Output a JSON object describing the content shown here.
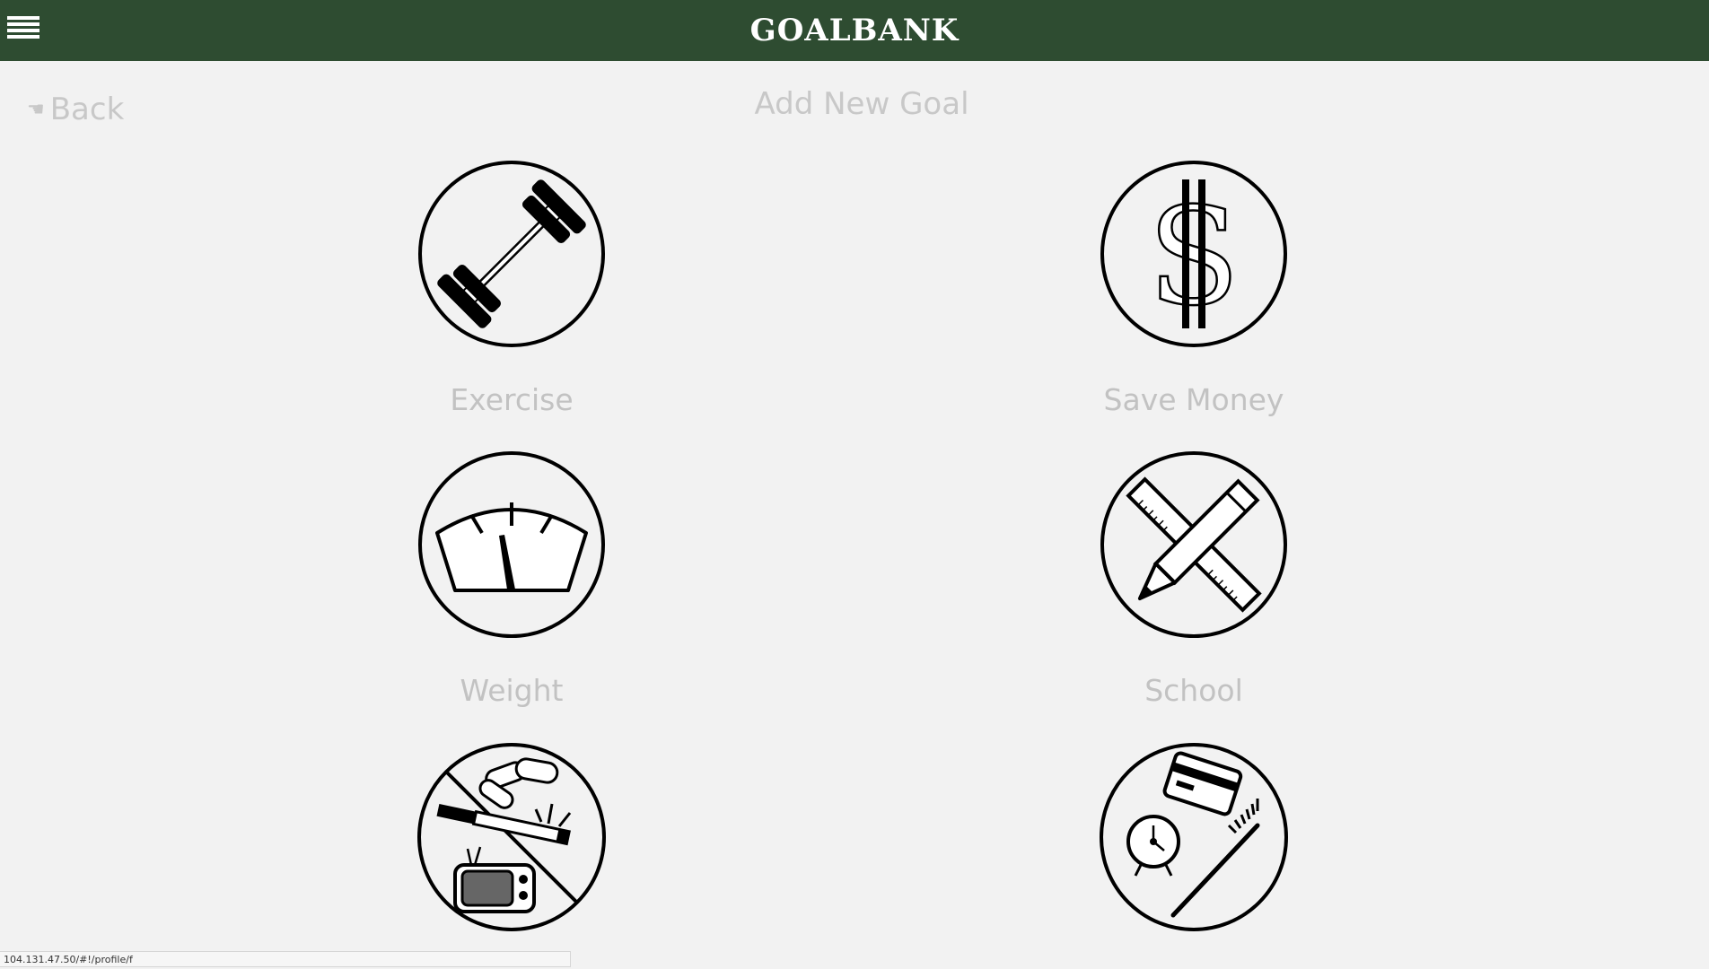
{
  "header": {
    "brand": "GOALBANK",
    "menu_icon": "hamburger-menu-icon"
  },
  "nav": {
    "back_label": "Back",
    "back_icon": "pointing-hand-icon"
  },
  "page": {
    "title": "Add New Goal"
  },
  "goals": [
    {
      "label": "Exercise",
      "icon": "dumbbell-icon"
    },
    {
      "label": "Save Money",
      "icon": "dollar-sign-icon"
    },
    {
      "label": "Weight",
      "icon": "scale-icon"
    },
    {
      "label": "School",
      "icon": "pencil-ruler-icon"
    },
    {
      "label": "",
      "icon": "no-bad-habits-icon"
    },
    {
      "label": "",
      "icon": "daily-routine-icon"
    }
  ],
  "status": {
    "url": "104.131.47.50/#!/profile/f"
  },
  "colors": {
    "header_bg": "#2e4c31",
    "page_bg": "#f2f2f2",
    "muted_text": "#c2c2c2"
  }
}
